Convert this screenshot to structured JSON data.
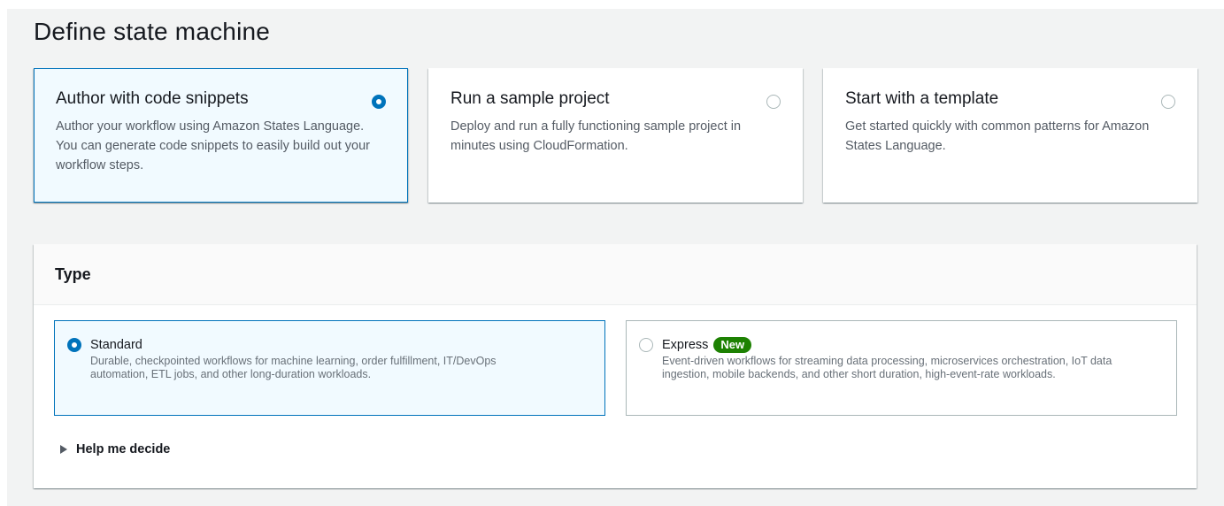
{
  "page": {
    "title": "Define state machine"
  },
  "tiles": [
    {
      "title": "Author with code snippets",
      "description": "Author your workflow using Amazon States Language. You can generate code snippets to easily build out your workflow steps.",
      "selected": true
    },
    {
      "title": "Run a sample project",
      "description": "Deploy and run a fully functioning sample project in minutes using CloudFormation.",
      "selected": false
    },
    {
      "title": "Start with a template",
      "description": "Get started quickly with common patterns for Amazon States Language.",
      "selected": false
    }
  ],
  "type_panel": {
    "title": "Type",
    "options": [
      {
        "title": "Standard",
        "description": "Durable, checkpointed workflows for machine learning, order fulfillment, IT/DevOps automation, ETL jobs, and other long-duration workloads.",
        "selected": true
      },
      {
        "title": "Express",
        "badge": "New",
        "description": "Event-driven workflows for streaming data processing, microservices orchestration, IoT data ingestion, mobile backends, and other short duration, high-event-rate workloads.",
        "selected": false
      }
    ],
    "help_label": "Help me decide"
  },
  "colors": {
    "accent": "#0073bb",
    "selected_bg": "#f1faff",
    "badge_green": "#1d8102"
  }
}
